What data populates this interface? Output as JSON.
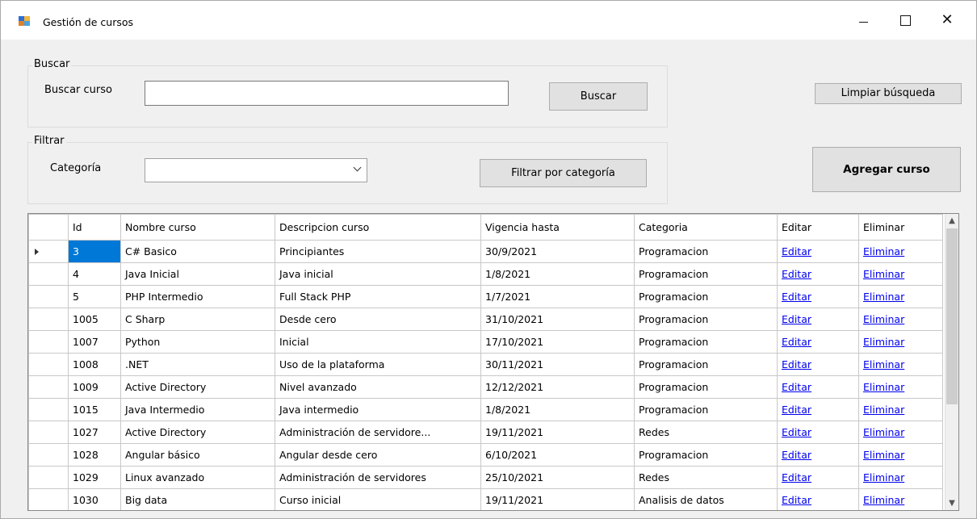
{
  "window": {
    "title": "Gestión de cursos",
    "minimize_glyph": "",
    "close_glyph": "✕"
  },
  "search_group": {
    "title": "Buscar",
    "label": "Buscar curso",
    "input_value": "",
    "button": "Buscar"
  },
  "filter_group": {
    "title": "Filtrar",
    "label": "Categoría",
    "selected": "",
    "button": "Filtrar por categoría"
  },
  "actions": {
    "clear_search": "Limpiar búsqueda",
    "add_course": "Agregar curso"
  },
  "grid": {
    "columns": [
      "Id",
      "Nombre curso",
      "Descripcion curso",
      "Vigencia hasta",
      "Categoria",
      "Editar",
      "Eliminar"
    ],
    "rows": [
      {
        "id": "3",
        "nombre": "C# Basico",
        "descripcion": "Principiantes",
        "vigencia": "30/9/2021",
        "categoria": "Programacion",
        "editar": "Editar",
        "eliminar": "Eliminar"
      },
      {
        "id": "4",
        "nombre": "Java Inicial",
        "descripcion": "Java inicial",
        "vigencia": "1/8/2021",
        "categoria": "Programacion",
        "editar": "Editar",
        "eliminar": "Eliminar"
      },
      {
        "id": "5",
        "nombre": "PHP Intermedio",
        "descripcion": "Full Stack PHP",
        "vigencia": "1/7/2021",
        "categoria": "Programacion",
        "editar": "Editar",
        "eliminar": "Eliminar"
      },
      {
        "id": "1005",
        "nombre": "C Sharp",
        "descripcion": "Desde cero",
        "vigencia": "31/10/2021",
        "categoria": "Programacion",
        "editar": "Editar",
        "eliminar": "Eliminar"
      },
      {
        "id": "1007",
        "nombre": "Python",
        "descripcion": "Inicial",
        "vigencia": "17/10/2021",
        "categoria": "Programacion",
        "editar": "Editar",
        "eliminar": "Eliminar"
      },
      {
        "id": "1008",
        "nombre": ".NET",
        "descripcion": "Uso de la plataforma",
        "vigencia": "30/11/2021",
        "categoria": "Programacion",
        "editar": "Editar",
        "eliminar": "Eliminar"
      },
      {
        "id": "1009",
        "nombre": "Active Directory",
        "descripcion": "Nivel avanzado",
        "vigencia": "12/12/2021",
        "categoria": "Programacion",
        "editar": "Editar",
        "eliminar": "Eliminar"
      },
      {
        "id": "1015",
        "nombre": "Java Intermedio",
        "descripcion": "Java intermedio",
        "vigencia": "1/8/2021",
        "categoria": "Programacion",
        "editar": "Editar",
        "eliminar": "Eliminar"
      },
      {
        "id": "1027",
        "nombre": "Active Directory",
        "descripcion": "Administración de servidore...",
        "vigencia": "19/11/2021",
        "categoria": "Redes",
        "editar": "Editar",
        "eliminar": "Eliminar"
      },
      {
        "id": "1028",
        "nombre": "Angular básico",
        "descripcion": "Angular desde cero",
        "vigencia": "6/10/2021",
        "categoria": "Programacion",
        "editar": "Editar",
        "eliminar": "Eliminar"
      },
      {
        "id": "1029",
        "nombre": "Linux avanzado",
        "descripcion": "Administración de servidores",
        "vigencia": "25/10/2021",
        "categoria": "Redes",
        "editar": "Editar",
        "eliminar": "Eliminar"
      },
      {
        "id": "1030",
        "nombre": "Big data",
        "descripcion": "Curso inicial",
        "vigencia": "19/11/2021",
        "categoria": "Analisis de datos",
        "editar": "Editar",
        "eliminar": "Eliminar"
      }
    ],
    "selected_row": 0,
    "scroll_up_glyph": "▲",
    "scroll_down_glyph": "▼"
  },
  "colors": {
    "selection": "#0078d7",
    "link": "#0000ee",
    "window_bg": "#f0f0f0"
  }
}
